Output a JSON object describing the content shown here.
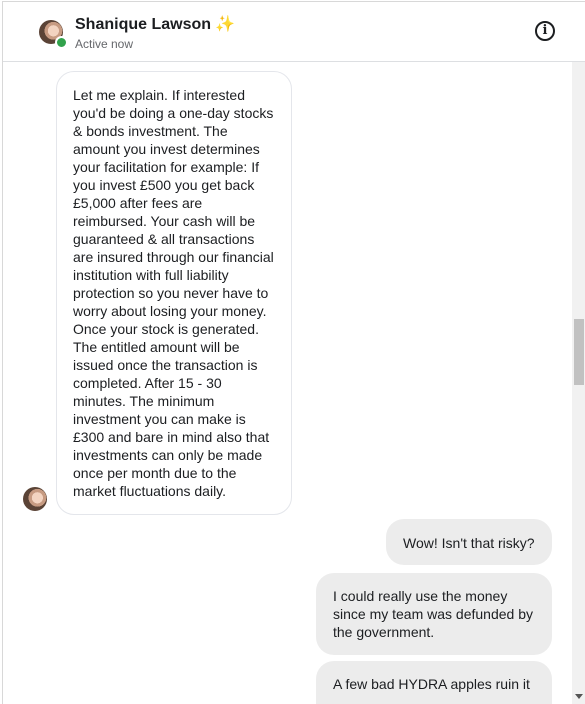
{
  "header": {
    "contact_name": "Shanique Lawson",
    "name_emoji": "✨",
    "status": "Active now",
    "info_icon": "info-circle-icon",
    "info_glyph": "i"
  },
  "messages": [
    {
      "direction": "incoming",
      "text": "Let me explain. If interested you'd be doing a one-day stocks & bonds investment. The amount you invest determines your facilitation for example: If you invest £500 you get back £5,000 after fees are reimbursed. Your cash will be guaranteed & all transactions are insured through our financial institution with full liability protection so you never have to worry about losing your money. Once your stock is generated. The entitled amount will be issued once the transaction is completed. After 15 - 30 minutes. The minimum investment you can make is £300 and bare in mind also that investments can only be made once per month due to the market fluctuations daily."
    },
    {
      "direction": "outgoing",
      "text": "Wow! Isn't that risky?"
    },
    {
      "direction": "outgoing",
      "text": "I could really use the money since my team was defunded by the government."
    },
    {
      "direction": "outgoing",
      "text": "A few bad HYDRA apples ruin it"
    }
  ],
  "colors": {
    "online": "#31a24c",
    "outgoing_bubble": "#ececec",
    "incoming_border": "#e4e6eb"
  }
}
